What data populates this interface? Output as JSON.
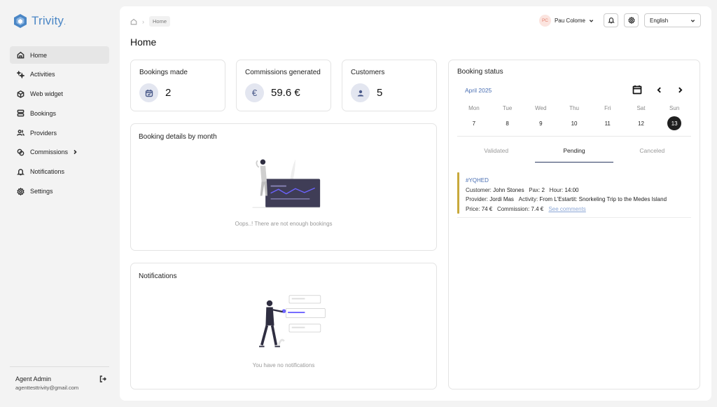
{
  "app": {
    "name": "Trivity",
    "name_dot": "."
  },
  "sidebar": {
    "items": [
      {
        "label": "Home"
      },
      {
        "label": "Activities"
      },
      {
        "label": "Web widget"
      },
      {
        "label": "Bookings"
      },
      {
        "label": "Providers"
      },
      {
        "label": "Commissions"
      },
      {
        "label": "Notifications"
      },
      {
        "label": "Settings"
      }
    ],
    "agent_name": "Agent Admin",
    "agent_email": "agenttesttrivity@gmail.com"
  },
  "header": {
    "breadcrumb_current": "Home",
    "page_title": "Home",
    "user_initials": "PC",
    "user_name": "Pau Colome",
    "language": "English"
  },
  "stats": {
    "bookings": {
      "title": "Bookings made",
      "value": "2"
    },
    "commissions": {
      "title": "Commissions generated",
      "value": "59.6 €",
      "icon_glyph": "€"
    },
    "customers": {
      "title": "Customers",
      "value": "5"
    }
  },
  "booking_details": {
    "title": "Booking details by month",
    "empty_text": "Oops..! There are not enough bookings"
  },
  "notifications": {
    "title": "Notifications",
    "empty_text": "You have no notifications"
  },
  "booking_status": {
    "title": "Booking status",
    "month": "April 2025",
    "days": [
      {
        "name": "Mon",
        "num": "7"
      },
      {
        "name": "Tue",
        "num": "8"
      },
      {
        "name": "Wed",
        "num": "9"
      },
      {
        "name": "Thu",
        "num": "10"
      },
      {
        "name": "Fri",
        "num": "11"
      },
      {
        "name": "Sat",
        "num": "12"
      },
      {
        "name": "Sun",
        "num": "13"
      }
    ],
    "tabs": [
      {
        "label": "Validated"
      },
      {
        "label": "Pending"
      },
      {
        "label": "Canceled"
      }
    ],
    "booking": {
      "code": "#YQHED",
      "customer_label": "Customer:",
      "customer": "John Stones",
      "pax_label": "Pax:",
      "pax": "2",
      "hour_label": "Hour:",
      "hour": "14:00",
      "provider_label": "Provider:",
      "provider": "Jordi Mas",
      "activity_label": "Activity:",
      "activity": "From L'Estartit: Snorkeling Trip to the Medes Island",
      "price_label": "Price:",
      "price": "74 €",
      "commission_label": "Commission:",
      "commission": "7.4 €",
      "comments_link": "See comments"
    }
  },
  "colors": {
    "brand": "#4a86c5",
    "status_pending": "#c8a93b",
    "selected_day": "#1f1f1f",
    "illustration_accent": "#6c63ff"
  }
}
